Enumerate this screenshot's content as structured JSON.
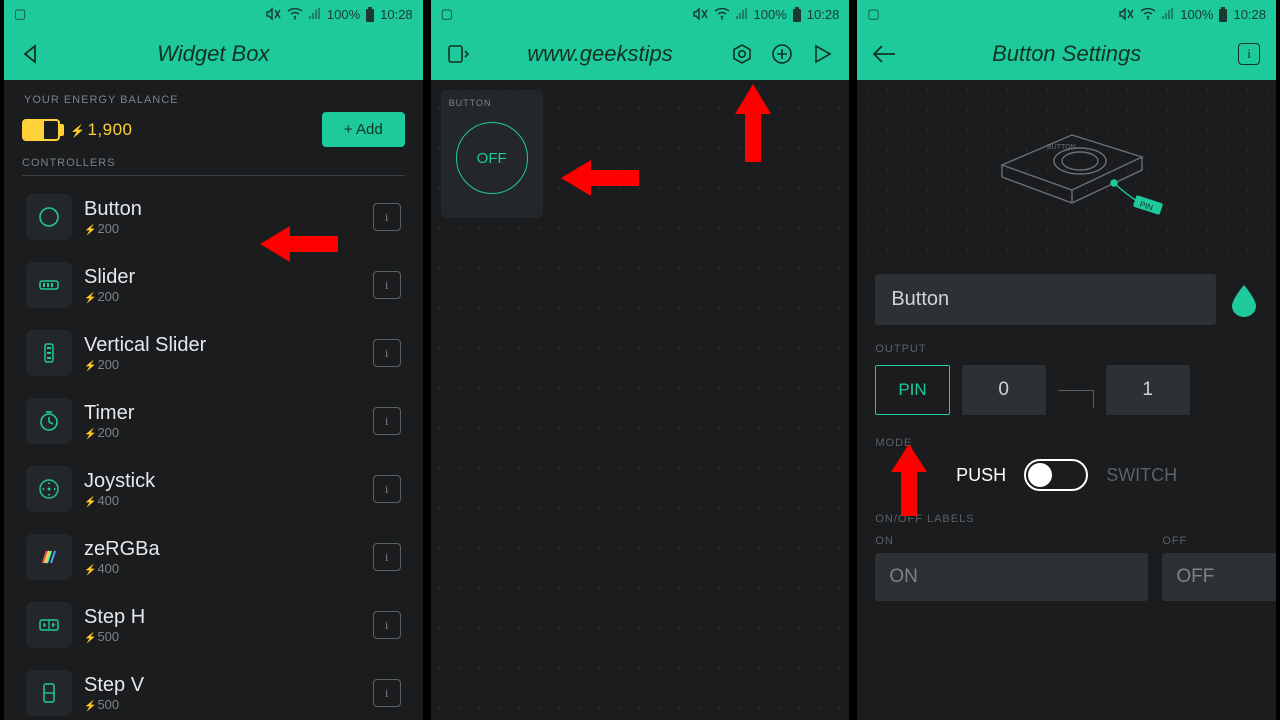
{
  "status": {
    "battery": "100%",
    "time": "10:28"
  },
  "screen1": {
    "title": "Widget Box",
    "balanceLabel": "YOUR ENERGY BALANCE",
    "balance": "1,900",
    "addButton": "+ Add",
    "sectionLabel": "CONTROLLERS",
    "widgets": [
      {
        "name": "Button",
        "cost": "200",
        "icon": "circle"
      },
      {
        "name": "Slider",
        "cost": "200",
        "icon": "slider"
      },
      {
        "name": "Vertical Slider",
        "cost": "200",
        "icon": "vslider"
      },
      {
        "name": "Timer",
        "cost": "200",
        "icon": "timer"
      },
      {
        "name": "Joystick",
        "cost": "400",
        "icon": "joystick"
      },
      {
        "name": "zeRGBa",
        "cost": "400",
        "icon": "rgb"
      },
      {
        "name": "Step H",
        "cost": "500",
        "icon": "steph"
      },
      {
        "name": "Step V",
        "cost": "500",
        "icon": "stepv"
      }
    ]
  },
  "screen2": {
    "title": "www.geekstips",
    "widgetLabel": "BUTTON",
    "buttonState": "OFF"
  },
  "screen3": {
    "title": "Button Settings",
    "nameValue": "Button",
    "outputLabel": "OUTPUT",
    "pin": "PIN",
    "val0": "0",
    "val1": "1",
    "modeLabel": "MODE",
    "push": "PUSH",
    "switch": "SWITCH",
    "labelsLabel": "ON/OFF LABELS",
    "onLabel": "ON",
    "offLabel": "OFF",
    "onValue": "ON",
    "offValue": "OFF",
    "illusTag": "PIN",
    "illusButton": "BUTTON"
  }
}
